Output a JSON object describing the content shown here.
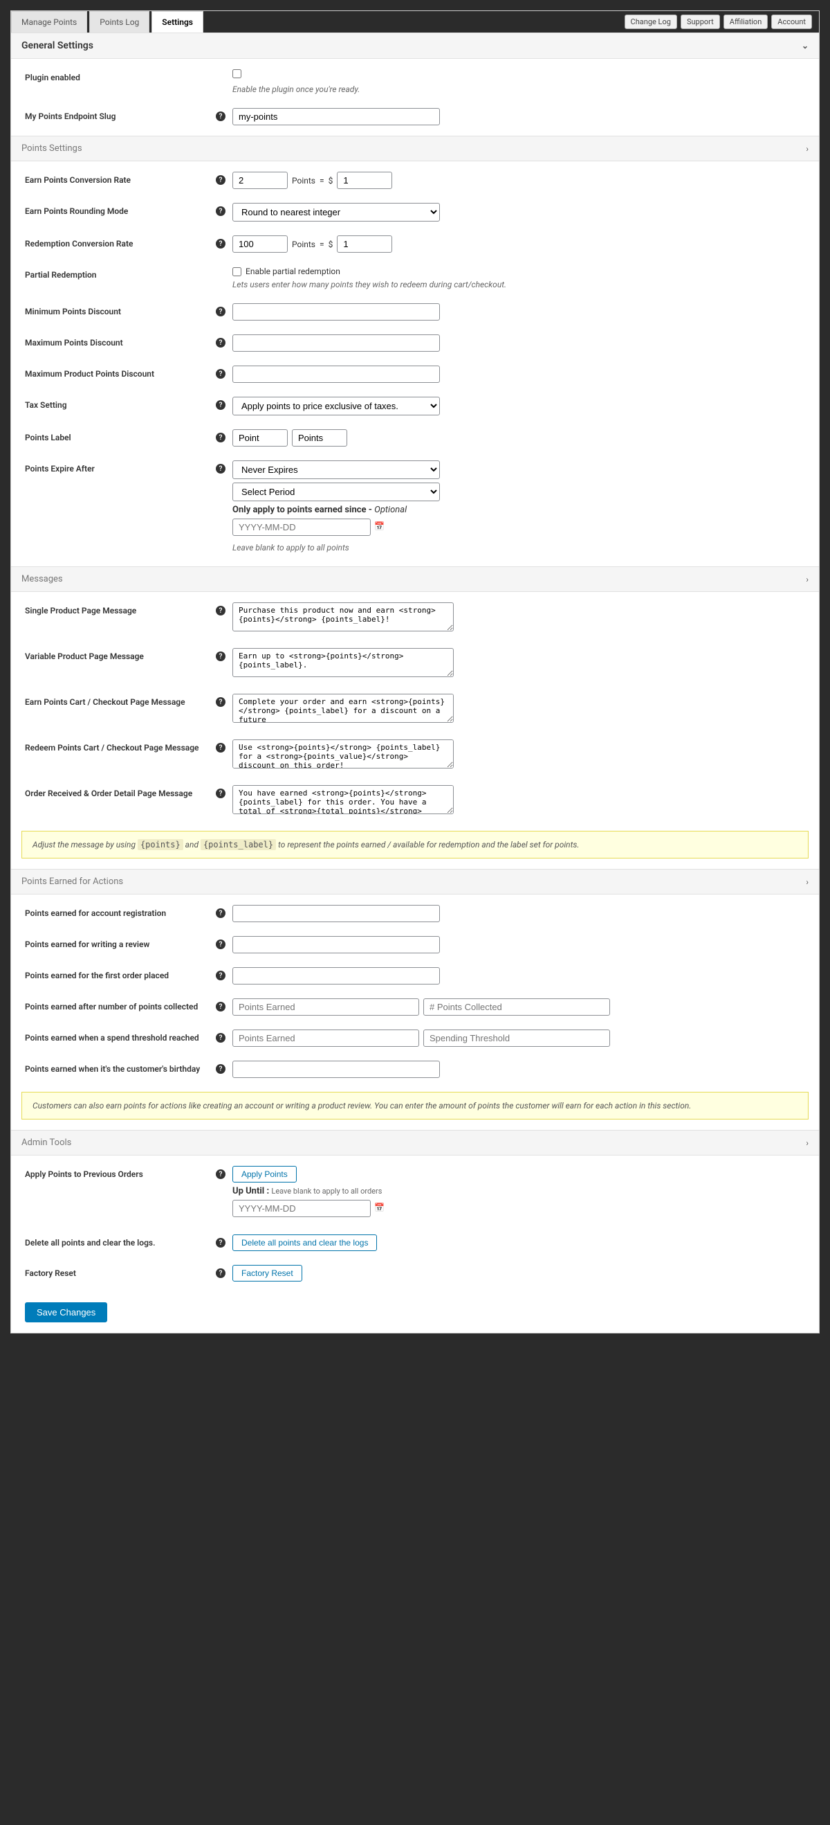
{
  "tabs": [
    "Manage Points",
    "Points Log",
    "Settings"
  ],
  "activeTab": "Settings",
  "toplinks": [
    "Change Log",
    "Support",
    "Affiliation",
    "Account"
  ],
  "sections": {
    "general": {
      "title": "General Settings",
      "plugin_enabled": {
        "label": "Plugin enabled",
        "desc": "Enable the plugin once you're ready."
      },
      "slug": {
        "label": "My Points Endpoint Slug",
        "value": "my-points"
      }
    },
    "points": {
      "title": "Points Settings",
      "earn_rate": {
        "label": "Earn Points Conversion Rate",
        "pts": "2",
        "unit": "Points",
        "eq": "=",
        "cur": "$",
        "val": "1"
      },
      "rounding": {
        "label": "Earn Points Rounding Mode",
        "value": "Round to nearest integer"
      },
      "redeem_rate": {
        "label": "Redemption Conversion Rate",
        "pts": "100",
        "unit": "Points",
        "eq": "=",
        "cur": "$",
        "val": "1"
      },
      "partial": {
        "label": "Partial Redemption",
        "check": "Enable partial redemption",
        "desc": "Lets users enter how many points they wish to redeem during cart/checkout."
      },
      "min_disc": {
        "label": "Minimum Points Discount"
      },
      "max_disc": {
        "label": "Maximum Points Discount"
      },
      "max_prod": {
        "label": "Maximum Product Points Discount"
      },
      "tax": {
        "label": "Tax Setting",
        "value": "Apply points to price exclusive of taxes."
      },
      "plabel": {
        "label": "Points Label",
        "sing": "Point",
        "plur": "Points"
      },
      "expire": {
        "label": "Points Expire After",
        "sel1": "Never Expires",
        "sel2": "Select Period",
        "since_label": "Only apply to points earned since - ",
        "since_opt": "Optional",
        "date_ph": "YYYY-MM-DD",
        "blank": "Leave blank to apply to all points"
      }
    },
    "messages": {
      "title": "Messages",
      "single": {
        "label": "Single Product Page Message",
        "value": "Purchase this product now and earn <strong>{points}</strong> {points_label}!"
      },
      "variable": {
        "label": "Variable Product Page Message",
        "value": "Earn up to <strong>{points}</strong> {points_label}."
      },
      "earn_cart": {
        "label": "Earn Points Cart / Checkout Page Message",
        "value": "Complete your order and earn <strong>{points}</strong> {points_label} for a discount on a future"
      },
      "redeem_cart": {
        "label": "Redeem Points Cart / Checkout Page Message",
        "value": "Use <strong>{points}</strong> {points_label} for a <strong>{points_value}</strong> discount on this order!"
      },
      "order_recv": {
        "label": "Order Received & Order Detail Page Message",
        "value": "You have earned <strong>{points}</strong> {points_label} for this order. You have a total of <strong>{total_points}</strong> {total_points_label}."
      },
      "note_pre": "Adjust the message by using ",
      "note_c1": "{points}",
      "note_mid": " and ",
      "note_c2": "{points_label}",
      "note_post": " to represent the points earned / available for redemption and the label set for points."
    },
    "actions": {
      "title": "Points Earned for Actions",
      "reg": {
        "label": "Points earned for account registration"
      },
      "review": {
        "label": "Points earned for writing a review"
      },
      "first": {
        "label": "Points earned for the first order placed"
      },
      "collected": {
        "label": "Points earned after number of points collected",
        "ph1": "Points Earned",
        "ph2": "# Points Collected"
      },
      "spend": {
        "label": "Points earned when a spend threshold reached",
        "ph1": "Points Earned",
        "ph2": "Spending Threshold"
      },
      "bday": {
        "label": "Points earned when it's the customer's birthday"
      },
      "note": "Customers can also earn points for actions like creating an account or writing a product review. You can enter the amount of points the customer will earn for each action in this section."
    },
    "admin": {
      "title": "Admin Tools",
      "apply": {
        "label": "Apply Points to Previous Orders",
        "btn": "Apply Points",
        "until": "Up Until :",
        "until_desc": "Leave blank to apply to all orders",
        "date_ph": "YYYY-MM-DD"
      },
      "delete": {
        "label": "Delete all points and clear the logs.",
        "btn": "Delete all points and clear the logs"
      },
      "factory": {
        "label": "Factory Reset",
        "btn": "Factory Reset"
      }
    }
  },
  "save": "Save Changes"
}
